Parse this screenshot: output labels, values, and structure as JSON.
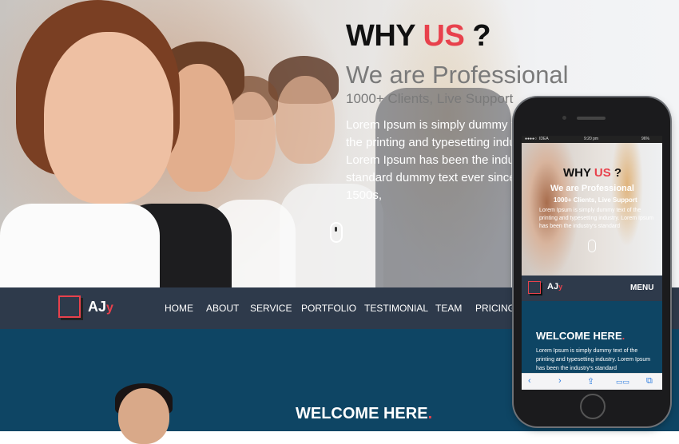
{
  "hero": {
    "why_prefix": "WHY ",
    "why_accent": "US",
    "why_suffix": " ?",
    "subtitle": "We are Professional",
    "clients": "1000+ Clients, Live Support",
    "lorem": "Lorem Ipsum is simply dummy text of the printing and typesetting industry. Lorem Ipsum has been the industry's standard dummy text ever since the 1500s,"
  },
  "logo": {
    "main": "AJ",
    "accent": "y"
  },
  "nav": {
    "items": [
      "HOME",
      "ABOUT",
      "SERVICE",
      "PORTFOLIO",
      "TESTIMONIAL",
      "TEAM",
      "PRICING"
    ]
  },
  "welcome": {
    "title": "WELCOME HERE",
    "dot": "."
  },
  "phone": {
    "status": {
      "carrier": "IDEA",
      "time": "9:20 pm",
      "battery": "96%"
    },
    "why_prefix": "WHY ",
    "why_accent": "US",
    "why_suffix": " ?",
    "subtitle": "We are Professional",
    "clients": "1000+ Clients, Live Support",
    "lorem": "Lorem Ipsum is simply dummy text of the printing and typesetting industry. Lorem Ipsum has been the industry's standard",
    "menu": "MENU",
    "welcome_title": "WELCOME HERE",
    "welcome_text": "Lorem Ipsum is simply dummy text of the printing and typesetting industry. Lorem Ipsum has been the industry's standard",
    "toolbar": [
      "‹",
      "›",
      "⇪",
      "📖",
      "⧉"
    ]
  },
  "colors": {
    "accent": "#e8414c",
    "nav_bg": "#2e3a4b",
    "section_bg": "#0e4564"
  }
}
